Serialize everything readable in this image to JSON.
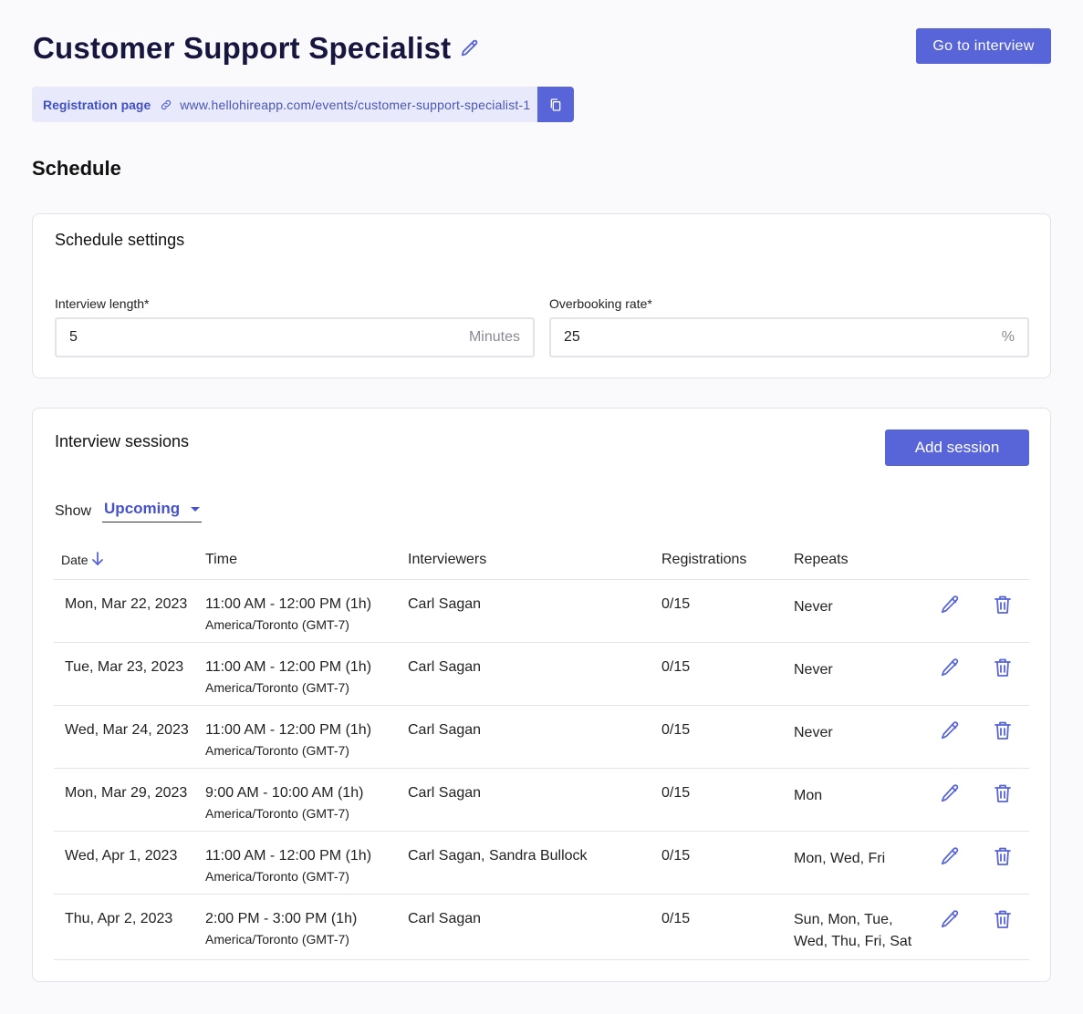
{
  "header": {
    "title": "Customer Support Specialist",
    "edit_icon": "pencil-icon",
    "go_button": "Go to interview"
  },
  "registration": {
    "label": "Registration page",
    "link_icon": "link-icon",
    "url": "www.hellohireapp.com/events/customer-support-specialist-1",
    "copy_icon": "copy-icon"
  },
  "schedule": {
    "title": "Schedule",
    "settings": {
      "title": "Schedule settings",
      "interview_length": {
        "label": "Interview length*",
        "value": "5",
        "suffix": "Minutes"
      },
      "overbooking_rate": {
        "label": "Overbooking rate*",
        "value": "25",
        "suffix": "%"
      }
    },
    "sessions": {
      "title": "Interview sessions",
      "add_button": "Add session",
      "show_label": "Show",
      "show_value": "Upcoming",
      "columns": {
        "date": "Date",
        "time": "Time",
        "interviewers": "Interviewers",
        "registrations": "Registrations",
        "repeats": "Repeats"
      },
      "rows": [
        {
          "date": "Mon, Mar 22, 2023",
          "time": "11:00 AM - 12:00 PM (1h)",
          "tz": "America/Toronto (GMT-7)",
          "interviewers": "Carl Sagan",
          "registrations": "0/15",
          "repeats": "Never"
        },
        {
          "date": "Tue, Mar 23, 2023",
          "time": "11:00 AM - 12:00 PM (1h)",
          "tz": "America/Toronto (GMT-7)",
          "interviewers": "Carl Sagan",
          "registrations": "0/15",
          "repeats": "Never"
        },
        {
          "date": "Wed, Mar 24, 2023",
          "time": "11:00 AM - 12:00 PM (1h)",
          "tz": "America/Toronto (GMT-7)",
          "interviewers": "Carl Sagan",
          "registrations": "0/15",
          "repeats": "Never"
        },
        {
          "date": "Mon, Mar 29, 2023",
          "time": "9:00 AM - 10:00 AM (1h)",
          "tz": "America/Toronto (GMT-7)",
          "interviewers": "Carl Sagan",
          "registrations": "0/15",
          "repeats": "Mon"
        },
        {
          "date": "Wed, Apr 1, 2023",
          "time": "11:00 AM - 12:00 PM (1h)",
          "tz": "America/Toronto (GMT-7)",
          "interviewers": "Carl Sagan, Sandra Bullock",
          "registrations": "0/15",
          "repeats": "Mon, Wed, Fri"
        },
        {
          "date": "Thu, Apr 2, 2023",
          "time": "2:00 PM - 3:00 PM (1h)",
          "tz": "America/Toronto (GMT-7)",
          "interviewers": "Carl Sagan",
          "registrations": "0/15",
          "repeats_line1": "Sun, Mon, Tue,",
          "repeats_line2": "Wed, Thu, Fri, Sat"
        }
      ]
    }
  },
  "colors": {
    "accent": "#5865d8",
    "accent_text": "#4652c9",
    "title": "#16163f",
    "reg_bg": "#e8eafb"
  }
}
